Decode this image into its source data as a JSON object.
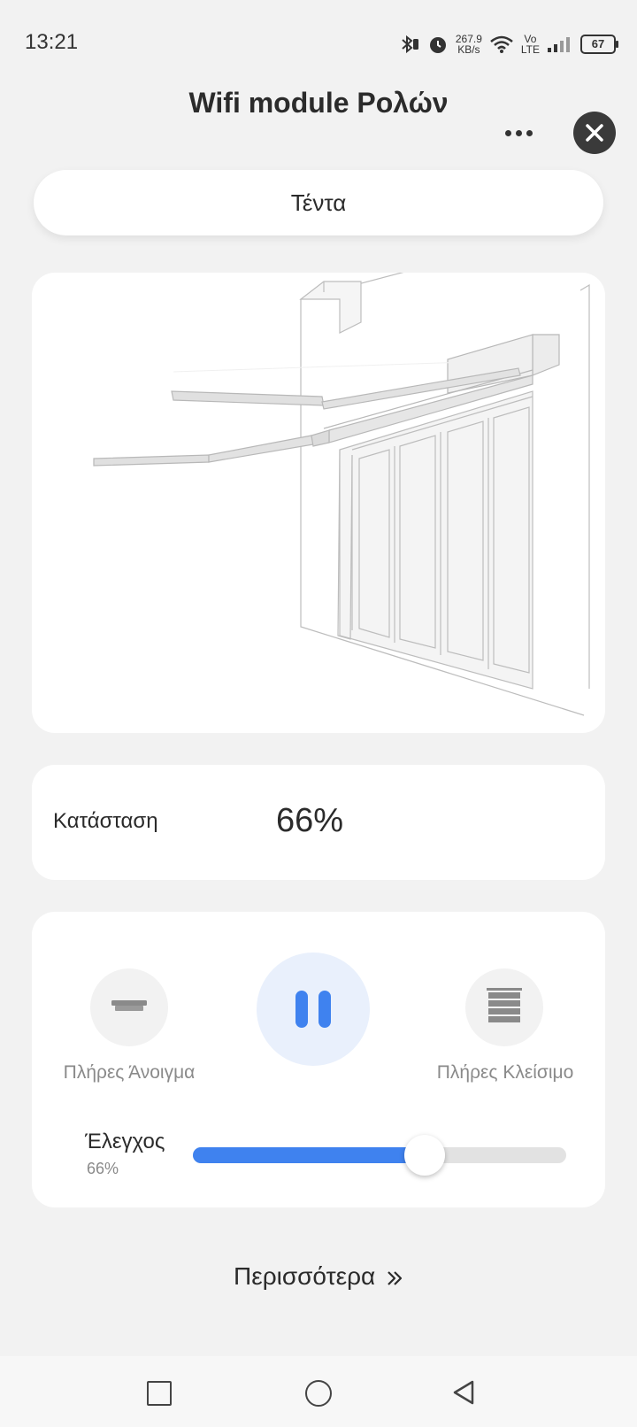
{
  "status_bar": {
    "time": "13:21",
    "net_speed_value": "267.9",
    "net_speed_unit": "KB/s",
    "volte_top": "Vo",
    "volte_bottom": "LTE",
    "battery": "67"
  },
  "header": {
    "title": "Wifi module Ρολών",
    "more_icon": "more-horizontal-icon",
    "close_icon": "close-icon"
  },
  "tab": {
    "label": "Τέντα"
  },
  "status_card": {
    "label": "Κατάσταση",
    "value": "66%"
  },
  "controls": {
    "open_label": "Πλήρες Άνοιγμα",
    "close_label": "Πλήρες Κλείσιμο",
    "slider_title": "Έλεγχος",
    "slider_value_text": "66%",
    "slider_level": 0.62,
    "accent_color": "#3f82ef"
  },
  "more_link": {
    "label": "Περισσότερα"
  }
}
